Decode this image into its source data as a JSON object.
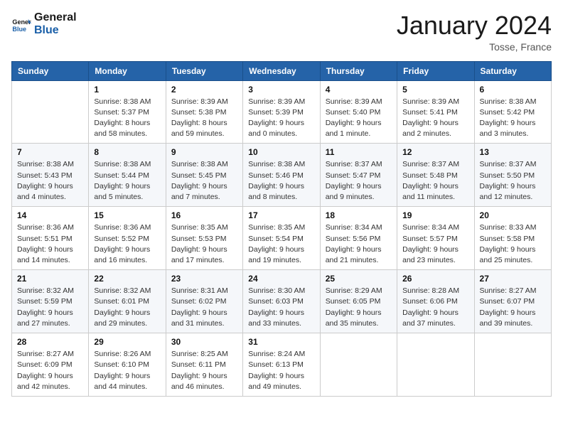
{
  "header": {
    "logo_general": "General",
    "logo_blue": "Blue",
    "month_year": "January 2024",
    "location": "Tosse, France"
  },
  "weekdays": [
    "Sunday",
    "Monday",
    "Tuesday",
    "Wednesday",
    "Thursday",
    "Friday",
    "Saturday"
  ],
  "weeks": [
    [
      {
        "day": "",
        "info": ""
      },
      {
        "day": "1",
        "info": "Sunrise: 8:38 AM\nSunset: 5:37 PM\nDaylight: 8 hours\nand 58 minutes."
      },
      {
        "day": "2",
        "info": "Sunrise: 8:39 AM\nSunset: 5:38 PM\nDaylight: 8 hours\nand 59 minutes."
      },
      {
        "day": "3",
        "info": "Sunrise: 8:39 AM\nSunset: 5:39 PM\nDaylight: 9 hours\nand 0 minutes."
      },
      {
        "day": "4",
        "info": "Sunrise: 8:39 AM\nSunset: 5:40 PM\nDaylight: 9 hours\nand 1 minute."
      },
      {
        "day": "5",
        "info": "Sunrise: 8:39 AM\nSunset: 5:41 PM\nDaylight: 9 hours\nand 2 minutes."
      },
      {
        "day": "6",
        "info": "Sunrise: 8:38 AM\nSunset: 5:42 PM\nDaylight: 9 hours\nand 3 minutes."
      }
    ],
    [
      {
        "day": "7",
        "info": "Sunrise: 8:38 AM\nSunset: 5:43 PM\nDaylight: 9 hours\nand 4 minutes."
      },
      {
        "day": "8",
        "info": "Sunrise: 8:38 AM\nSunset: 5:44 PM\nDaylight: 9 hours\nand 5 minutes."
      },
      {
        "day": "9",
        "info": "Sunrise: 8:38 AM\nSunset: 5:45 PM\nDaylight: 9 hours\nand 7 minutes."
      },
      {
        "day": "10",
        "info": "Sunrise: 8:38 AM\nSunset: 5:46 PM\nDaylight: 9 hours\nand 8 minutes."
      },
      {
        "day": "11",
        "info": "Sunrise: 8:37 AM\nSunset: 5:47 PM\nDaylight: 9 hours\nand 9 minutes."
      },
      {
        "day": "12",
        "info": "Sunrise: 8:37 AM\nSunset: 5:48 PM\nDaylight: 9 hours\nand 11 minutes."
      },
      {
        "day": "13",
        "info": "Sunrise: 8:37 AM\nSunset: 5:50 PM\nDaylight: 9 hours\nand 12 minutes."
      }
    ],
    [
      {
        "day": "14",
        "info": "Sunrise: 8:36 AM\nSunset: 5:51 PM\nDaylight: 9 hours\nand 14 minutes."
      },
      {
        "day": "15",
        "info": "Sunrise: 8:36 AM\nSunset: 5:52 PM\nDaylight: 9 hours\nand 16 minutes."
      },
      {
        "day": "16",
        "info": "Sunrise: 8:35 AM\nSunset: 5:53 PM\nDaylight: 9 hours\nand 17 minutes."
      },
      {
        "day": "17",
        "info": "Sunrise: 8:35 AM\nSunset: 5:54 PM\nDaylight: 9 hours\nand 19 minutes."
      },
      {
        "day": "18",
        "info": "Sunrise: 8:34 AM\nSunset: 5:56 PM\nDaylight: 9 hours\nand 21 minutes."
      },
      {
        "day": "19",
        "info": "Sunrise: 8:34 AM\nSunset: 5:57 PM\nDaylight: 9 hours\nand 23 minutes."
      },
      {
        "day": "20",
        "info": "Sunrise: 8:33 AM\nSunset: 5:58 PM\nDaylight: 9 hours\nand 25 minutes."
      }
    ],
    [
      {
        "day": "21",
        "info": "Sunrise: 8:32 AM\nSunset: 5:59 PM\nDaylight: 9 hours\nand 27 minutes."
      },
      {
        "day": "22",
        "info": "Sunrise: 8:32 AM\nSunset: 6:01 PM\nDaylight: 9 hours\nand 29 minutes."
      },
      {
        "day": "23",
        "info": "Sunrise: 8:31 AM\nSunset: 6:02 PM\nDaylight: 9 hours\nand 31 minutes."
      },
      {
        "day": "24",
        "info": "Sunrise: 8:30 AM\nSunset: 6:03 PM\nDaylight: 9 hours\nand 33 minutes."
      },
      {
        "day": "25",
        "info": "Sunrise: 8:29 AM\nSunset: 6:05 PM\nDaylight: 9 hours\nand 35 minutes."
      },
      {
        "day": "26",
        "info": "Sunrise: 8:28 AM\nSunset: 6:06 PM\nDaylight: 9 hours\nand 37 minutes."
      },
      {
        "day": "27",
        "info": "Sunrise: 8:27 AM\nSunset: 6:07 PM\nDaylight: 9 hours\nand 39 minutes."
      }
    ],
    [
      {
        "day": "28",
        "info": "Sunrise: 8:27 AM\nSunset: 6:09 PM\nDaylight: 9 hours\nand 42 minutes."
      },
      {
        "day": "29",
        "info": "Sunrise: 8:26 AM\nSunset: 6:10 PM\nDaylight: 9 hours\nand 44 minutes."
      },
      {
        "day": "30",
        "info": "Sunrise: 8:25 AM\nSunset: 6:11 PM\nDaylight: 9 hours\nand 46 minutes."
      },
      {
        "day": "31",
        "info": "Sunrise: 8:24 AM\nSunset: 6:13 PM\nDaylight: 9 hours\nand 49 minutes."
      },
      {
        "day": "",
        "info": ""
      },
      {
        "day": "",
        "info": ""
      },
      {
        "day": "",
        "info": ""
      }
    ]
  ]
}
